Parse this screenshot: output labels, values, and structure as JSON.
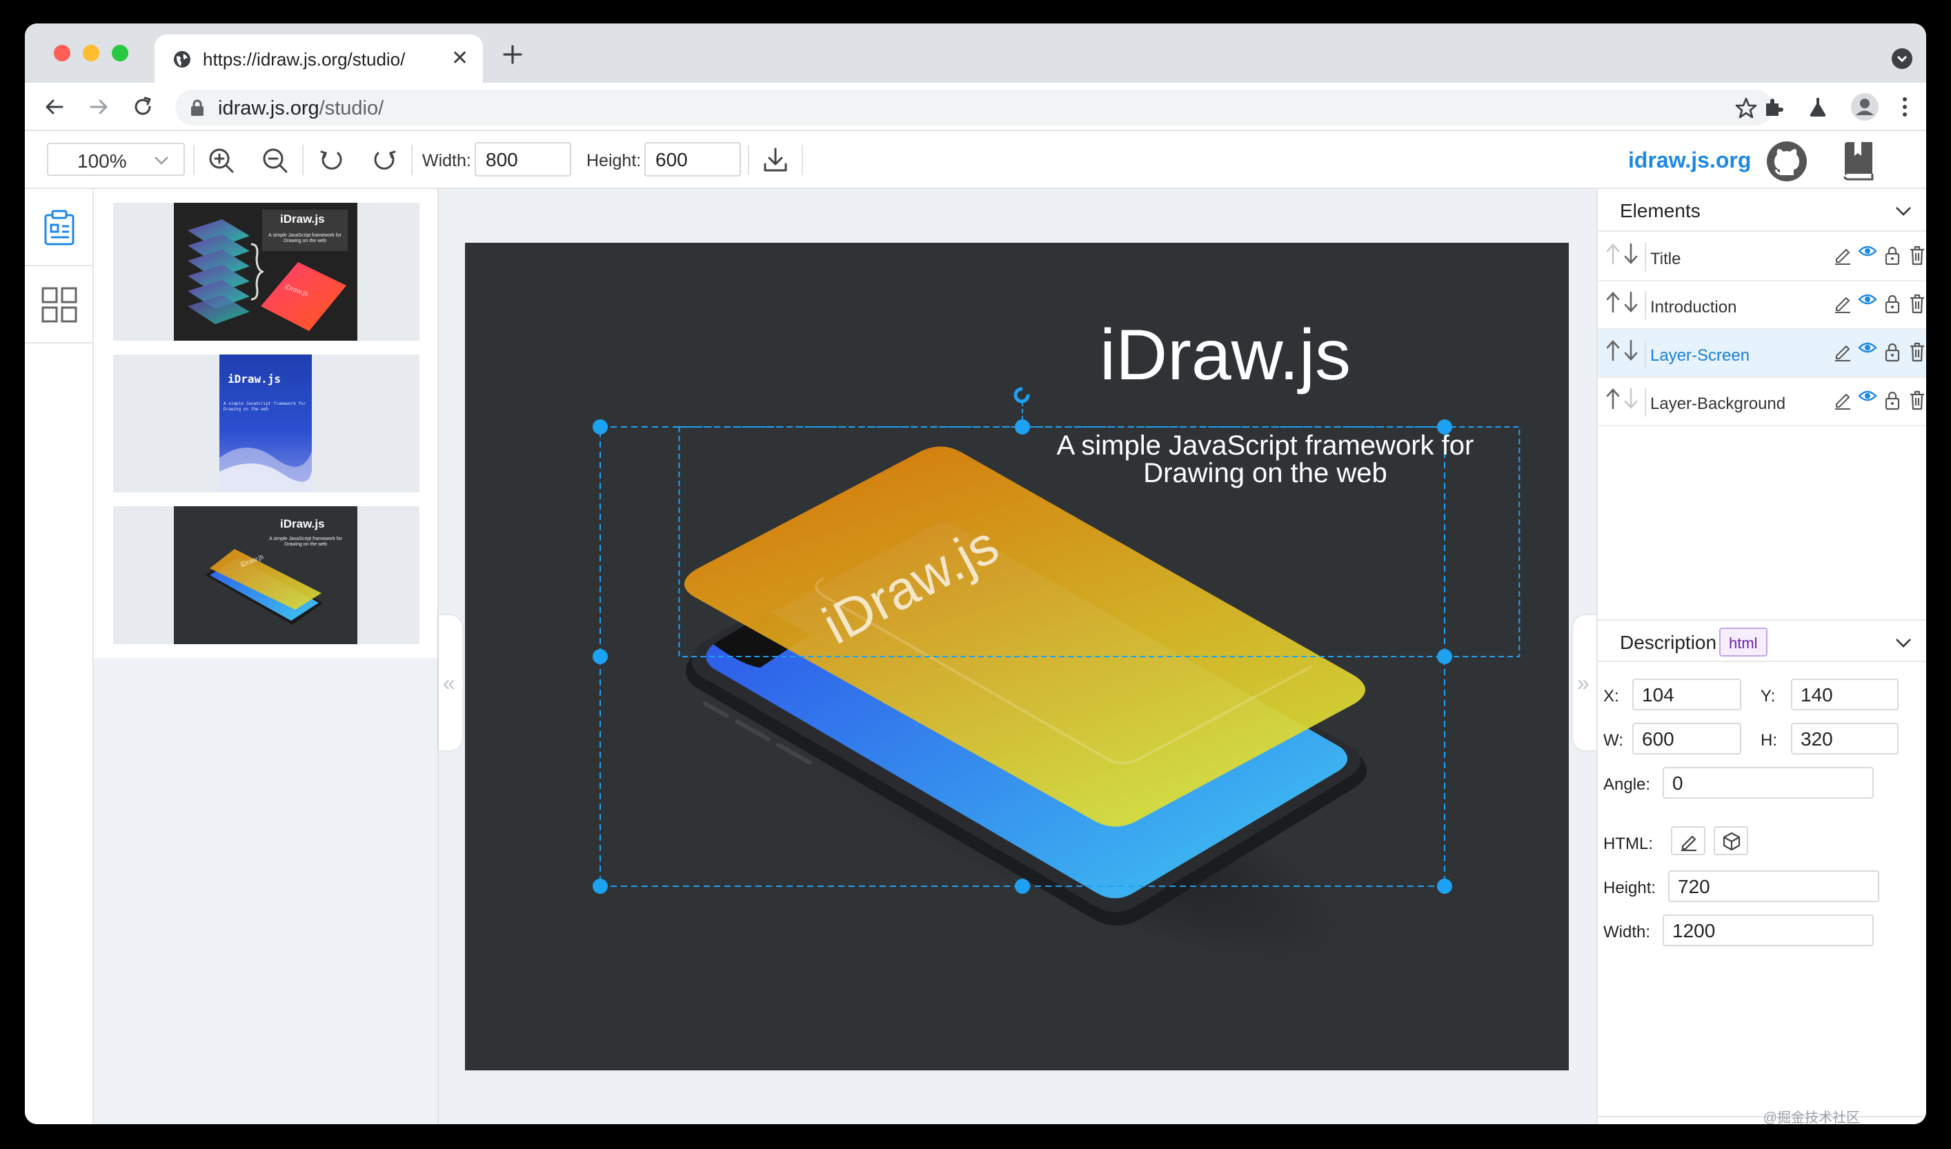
{
  "browser": {
    "tab_title": "https://idraw.js.org/studio/",
    "tab_close": "✕",
    "url_host": "idraw.js.org",
    "url_path": "/studio/"
  },
  "toolbar": {
    "zoom": "100%",
    "width_label": "Width:",
    "width_value": "800",
    "height_label": "Height:",
    "height_value": "600",
    "brand": "idraw.js.org"
  },
  "thumbnails": [
    {
      "title": "iDraw.js",
      "subtitle": "A simple JavaScript framework for Drawing on the web",
      "card_text": "iDraw.js"
    },
    {
      "title": "iDraw.js",
      "subtitle": "A simple JavaScript framework for Drawing on the web"
    },
    {
      "title": "iDraw.js",
      "subtitle": "A simple JavaScript framework for Drawing on the web",
      "card_text": "iDraw.js"
    }
  ],
  "canvas": {
    "title": "iDraw.js",
    "intro_line1": "A simple JavaScript framework for",
    "intro_line2": "Drawing on the web",
    "card_text": "iDraw.js"
  },
  "elements_panel": {
    "title": "Elements",
    "items": [
      {
        "name": "Title",
        "active": false
      },
      {
        "name": "Introduction",
        "active": false
      },
      {
        "name": "Layer-Screen",
        "active": true
      },
      {
        "name": "Layer-Background",
        "active": false
      }
    ]
  },
  "description_panel": {
    "title": "Description",
    "type_badge": "html",
    "x_label": "X:",
    "x_value": "104",
    "y_label": "Y:",
    "y_value": "140",
    "w_label": "W:",
    "w_value": "600",
    "h_label": "H:",
    "h_value": "320",
    "angle_label": "Angle:",
    "angle_value": "0",
    "html_label": "HTML:",
    "height_label": "Height:",
    "height_value": "720",
    "width_label": "Width:",
    "width_value": "1200"
  },
  "watermark": "@掘金技术社区",
  "colors": {
    "accent": "#1e88e5",
    "selection": "#1da1f2",
    "canvas_bg": "#303336"
  }
}
